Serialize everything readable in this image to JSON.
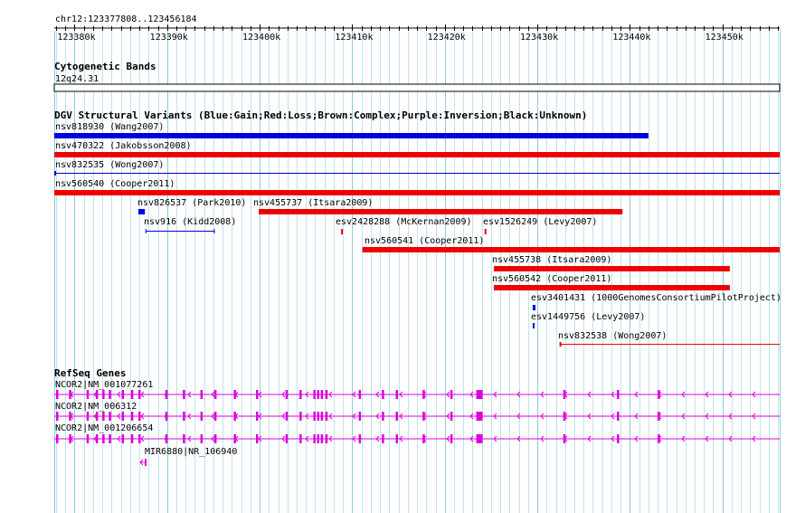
{
  "ruler": {
    "position_label": "chr12:123377808..123456184",
    "start": 123377808,
    "end": 123456184,
    "ticks": [
      {
        "pos": 123380000,
        "label": "123380k"
      },
      {
        "pos": 123390000,
        "label": "123390k"
      },
      {
        "pos": 123400000,
        "label": "123400k"
      },
      {
        "pos": 123410000,
        "label": "123410k"
      },
      {
        "pos": 123420000,
        "label": "123420k"
      },
      {
        "pos": 123430000,
        "label": "123430k"
      },
      {
        "pos": 123440000,
        "label": "123440k"
      },
      {
        "pos": 123450000,
        "label": "123450k"
      }
    ]
  },
  "tracks": {
    "cyto": {
      "title": "Cytogenetic Bands",
      "band": "12q24.31"
    },
    "dgv": {
      "title": "DGV Structural Variants (Blue:Gain;Red:Loss;Brown:Complex;Purple:Inversion;Black:Unknown)",
      "colors": {
        "gain": "#0000dd",
        "loss": "#ee0000"
      },
      "variants": [
        {
          "id": "nsv818930 (Wang2007)",
          "start": 123377808,
          "end": 123442000,
          "type": "gain",
          "glyph": "bar"
        },
        {
          "id": "nsv470322 (Jakobsson2008)",
          "start": 123377808,
          "end": 123456184,
          "type": "loss",
          "glyph": "bar"
        },
        {
          "id": "nsv832535 (Wong2007)",
          "start": 123377808,
          "end": 123456184,
          "type": "gain",
          "glyph": "line"
        },
        {
          "id": "nsv560540 (Cooper2011)",
          "start": 123377808,
          "end": 123456184,
          "type": "loss",
          "glyph": "bar"
        },
        {
          "id": "nsv826537 (Park2010)",
          "start": 123386900,
          "end": 123387600,
          "type": "gain",
          "glyph": "bar"
        },
        {
          "id": "nsv455737 (Itsara2009)",
          "start": 123399900,
          "end": 123439200,
          "type": "loss",
          "glyph": "bar"
        },
        {
          "id": "nsv916 (Kidd2008)",
          "start": 123387700,
          "end": 123395100,
          "type": "gain",
          "glyph": "range"
        },
        {
          "id": "esv2428288 (McKernan2009)",
          "start": 123408800,
          "end": 123408950,
          "type": "loss",
          "glyph": "tick"
        },
        {
          "id": "esv1526249 (Levy2007)",
          "start": 123424300,
          "end": 123424450,
          "type": "loss",
          "glyph": "tick"
        },
        {
          "id": "nsv560541 (Cooper2011)",
          "start": 123411100,
          "end": 123456184,
          "type": "loss",
          "glyph": "bar"
        },
        {
          "id": "nsv455738 (Itsara2009)",
          "start": 123425300,
          "end": 123450800,
          "type": "loss",
          "glyph": "bar"
        },
        {
          "id": "nsv560542 (Cooper2011)",
          "start": 123425300,
          "end": 123450800,
          "type": "loss",
          "glyph": "bar"
        },
        {
          "id": "esv3401431 (1000GenomesConsortiumPilotProject)",
          "start": 123429500,
          "end": 123429800,
          "type": "gain",
          "glyph": "bar"
        },
        {
          "id": "esv1449756 (Levy2007)",
          "start": 123429500,
          "end": 123429650,
          "type": "gain",
          "glyph": "tick"
        },
        {
          "id": "nsv832538 (Wong2007)",
          "start": 123432400,
          "end": 123456184,
          "type": "loss",
          "glyph": "line"
        }
      ]
    },
    "refseq": {
      "title": "RefSeq Genes",
      "color": "#dd00dd",
      "genes": [
        {
          "name": "NCOR2|NM_001077261"
        },
        {
          "name": "NCOR2|NM_006312"
        },
        {
          "name": "NCOR2|NM_001206654"
        },
        {
          "name": "MIR6880|NR_106940"
        }
      ],
      "exons": [
        123378000,
        123379400,
        123381300,
        123382300,
        123383000,
        123383700,
        123385100,
        123386100,
        123386900,
        123389800,
        123391700,
        123393600,
        123395100,
        123397200,
        123399600,
        123402800,
        123404300,
        123405800,
        123406200,
        123406600,
        123407100,
        123410700,
        123413200,
        123414700,
        123417600,
        123420600,
        123432800,
        123438600,
        123443000
      ],
      "utr": [
        123423400
      ]
    }
  }
}
